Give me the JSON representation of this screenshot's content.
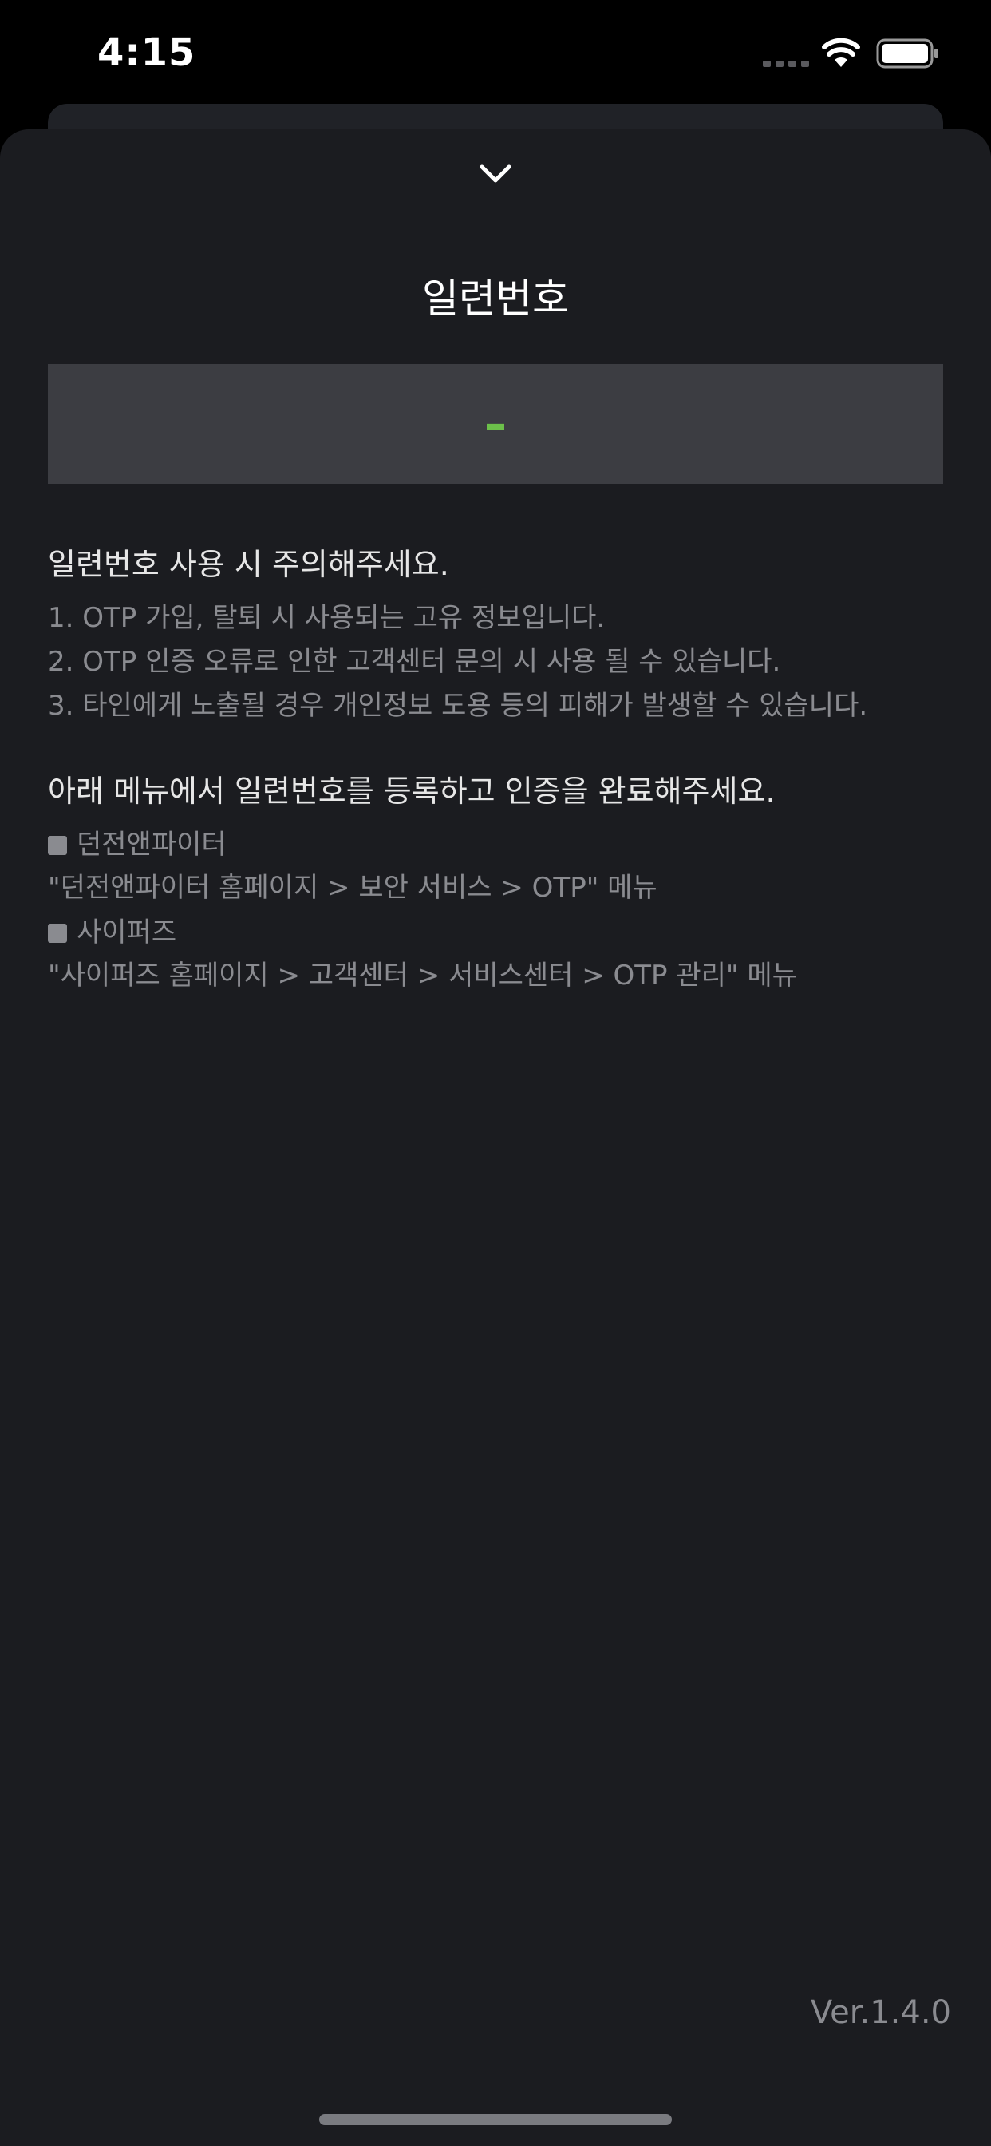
{
  "status_bar": {
    "time": "4:15",
    "icons": [
      "signal-icon",
      "wifi-icon",
      "battery-icon"
    ]
  },
  "sheet": {
    "close_icon": "chevron-down-icon",
    "title": "일련번호",
    "serial_value": "–"
  },
  "caution": {
    "heading": "일련번호 사용 시 주의해주세요.",
    "items": [
      "1. OTP 가입, 탈퇴 시 사용되는 고유 정보입니다.",
      "2. OTP 인증 오류로 인한 고객센터 문의 시 사용 될 수 있습니다.",
      "3. 타인에게 노출될 경우 개인정보 도용 등의 피해가 발생할 수 있습니다."
    ]
  },
  "register": {
    "heading": "아래 메뉴에서 일련번호를 등록하고 인증을 완료해주세요.",
    "games": [
      {
        "name": "던전앤파이터",
        "path": "\"던전앤파이터 홈페이지 > 보안 서비스 > OTP\" 메뉴"
      },
      {
        "name": "사이퍼즈",
        "path": "\"사이퍼즈 홈페이지 > 고객센터 > 서비스센터 > OTP 관리\" 메뉴"
      }
    ]
  },
  "footer": {
    "version": "Ver.1.4.0"
  },
  "colors": {
    "background": "#000000",
    "sheet": "#1b1c20",
    "serial_box": "#3c3d42",
    "accent": "#6cc04a",
    "muted_text": "#8a8b90"
  }
}
